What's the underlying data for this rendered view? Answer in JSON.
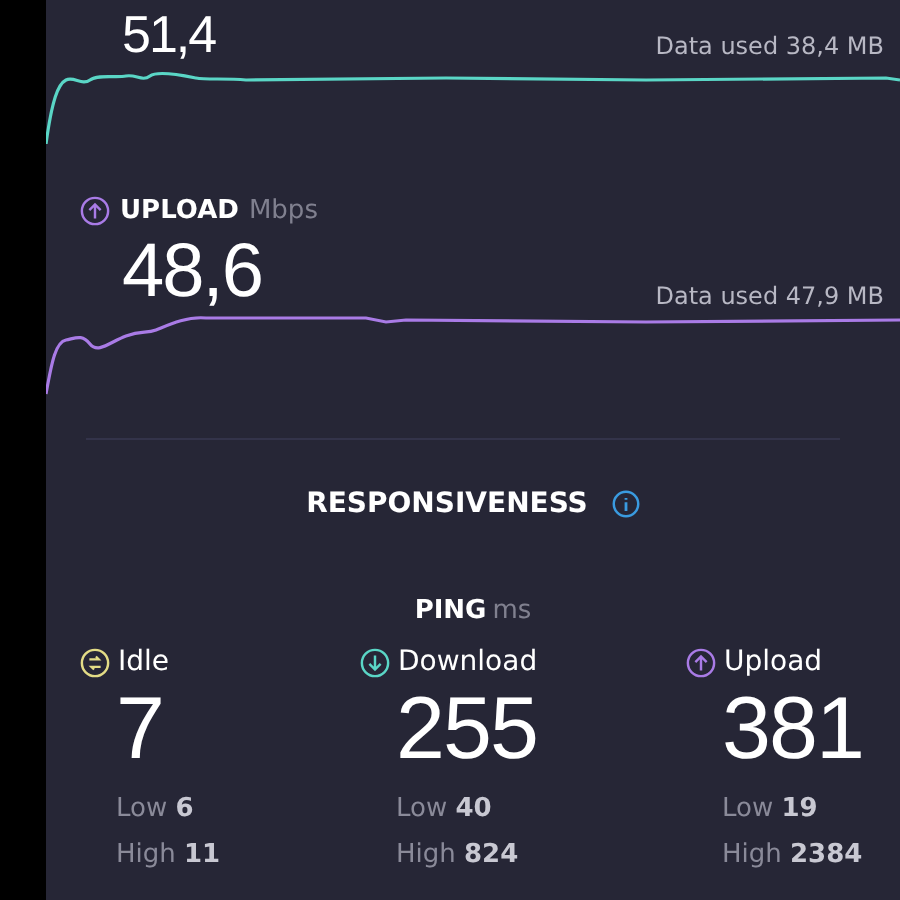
{
  "download": {
    "value": "51,4",
    "data_used": "Data used 38,4 MB"
  },
  "upload": {
    "label": "UPLOAD",
    "unit": "Mbps",
    "value": "48,6",
    "data_used": "Data used 47,9 MB"
  },
  "responsiveness": {
    "title": "RESPONSIVENESS"
  },
  "ping": {
    "label": "PING",
    "unit": "ms",
    "columns": [
      {
        "kind": "idle",
        "label": "Idle",
        "value": "7",
        "low": "Low **6**",
        "high": "High **11**"
      },
      {
        "kind": "download",
        "label": "Download",
        "value": "255",
        "low": "Low **40**",
        "high": "High **824**"
      },
      {
        "kind": "upload",
        "label": "Upload",
        "value": "381",
        "low": "Low **19**",
        "high": "High **2384**"
      }
    ]
  }
}
